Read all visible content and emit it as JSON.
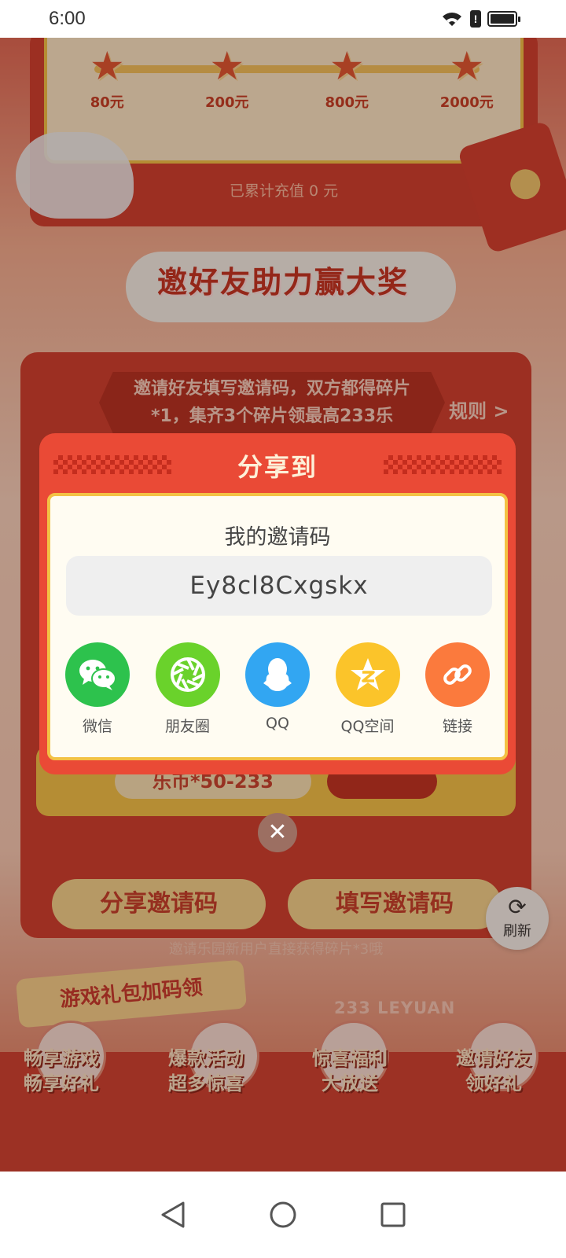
{
  "status_bar": {
    "time": "6:00"
  },
  "recharge": {
    "milestones": [
      "80元",
      "200元",
      "800元",
      "2000元"
    ],
    "total_text": "已累计充值 0 元"
  },
  "invite": {
    "title": "邀好友助力赢大奖",
    "banner_text": "邀请好友填写邀请码，双方都得碎片*1，集齐3个碎片领最高233乐",
    "rules_link": "规则 >",
    "hidden_reward": "乐币*50-233",
    "share_button": "分享邀请码",
    "fill_button": "填写邀请码",
    "note": "邀请乐园新用户直接获得碎片*3哦"
  },
  "refresh": {
    "label": "刷新"
  },
  "gift": {
    "tag": "游戏礼包加码领",
    "brand": "233 LEYUAN",
    "promos": [
      "畅享游戏\n畅享好礼",
      "爆款活动\n超多惊喜",
      "惊喜福利\n大放送",
      "邀请好友\n领好礼"
    ]
  },
  "modal": {
    "title": "分享到",
    "label": "我的邀请码",
    "code": "Ey8cl8Cxgskx",
    "targets": [
      {
        "label": "微信",
        "icon": "wechat-icon",
        "color": "#2dc24d"
      },
      {
        "label": "朋友圈",
        "icon": "moments-icon",
        "color": "#6ad22b"
      },
      {
        "label": "QQ",
        "icon": "qq-icon",
        "color": "#32a6f2"
      },
      {
        "label": "QQ空间",
        "icon": "qzone-icon",
        "color": "#fbc42a"
      },
      {
        "label": "链接",
        "icon": "link-icon",
        "color": "#fb7a3d"
      }
    ]
  },
  "colors": {
    "accent": "#ea4a36",
    "frame": "#f3c245"
  }
}
